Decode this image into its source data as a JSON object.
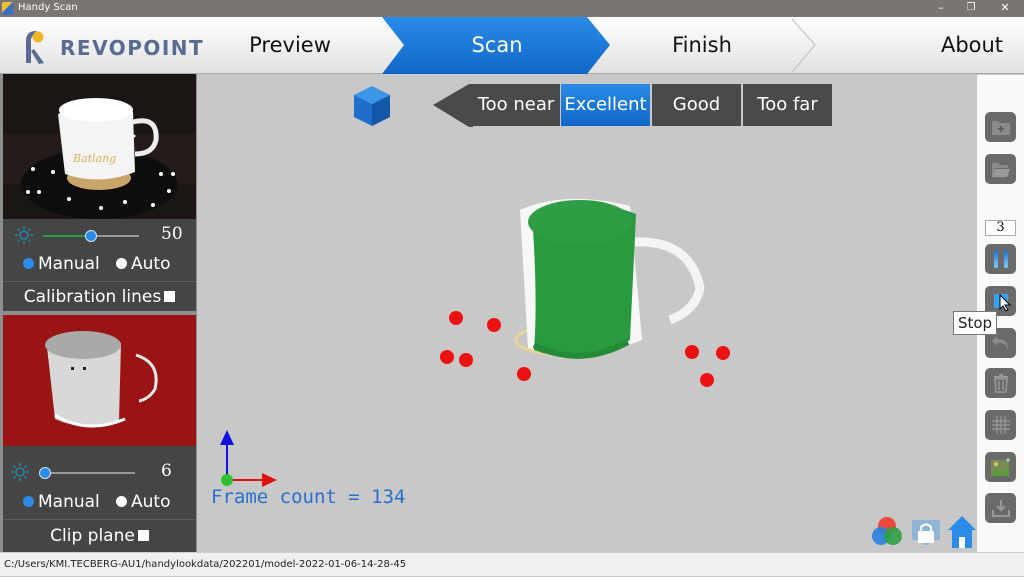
{
  "window": {
    "title": "Handy Scan",
    "minimize": "–",
    "restore": "❐",
    "close": "✕"
  },
  "logo": {
    "text": "REVOPOINT"
  },
  "steps": [
    {
      "label": "Preview",
      "active": false
    },
    {
      "label": "Scan",
      "active": true
    },
    {
      "label": "Finish",
      "active": false
    },
    {
      "label": "About",
      "active": false
    }
  ],
  "distance": {
    "options": [
      "Too near",
      "Excellent",
      "Good",
      "Too far"
    ],
    "selected": "Excellent"
  },
  "colors": {
    "accent": "#1a78d9",
    "mesh": "#2a9a40",
    "markers": "#ee1111",
    "depth_bg": "#9a1414"
  },
  "rgb_panel": {
    "slider_value": "50",
    "slider_fraction": 0.5,
    "mode_manual": "Manual",
    "mode_auto": "Auto",
    "mode_selected": "Manual",
    "checkbox_label": "Calibration lines"
  },
  "depth_panel": {
    "slider_value": "6",
    "slider_fraction": 0.0,
    "mode_manual": "Manual",
    "mode_auto": "Auto",
    "mode_selected": "Manual",
    "checkbox_label": "Clip plane"
  },
  "viewport": {
    "frame_count_text": "Frame count = 134",
    "frame_count": 134
  },
  "toolbar": {
    "frame_counter": "3",
    "tooltip": "Stop",
    "tools": [
      "new-project",
      "open-project",
      "pause",
      "stop",
      "undo",
      "delete",
      "grid",
      "texture",
      "export"
    ]
  },
  "status": {
    "path": "C:/Users/KMI.TECBERG-AU1/handylookdata/202201/model-2022-01-06-14-28-45"
  }
}
